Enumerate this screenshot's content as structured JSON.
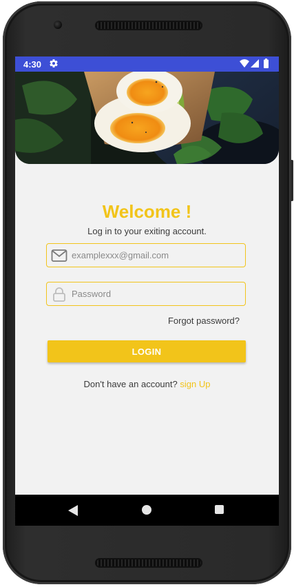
{
  "status_bar": {
    "time": "4:30",
    "settings_icon": "gear-icon",
    "wifi_icon": "wifi-icon",
    "signal_icon": "cell-signal-icon",
    "battery_icon": "battery-icon",
    "background_color": "#3d4fd6"
  },
  "hero": {
    "image": "food-photo-eggs-avocado-toast"
  },
  "login": {
    "title": "Welcome !",
    "subtitle": "Log in to your exiting account.",
    "email_placeholder": "examplexxx@gmail.com",
    "email_icon": "mail-icon",
    "password_placeholder": "Password",
    "password_icon": "lock-icon",
    "forgot_password": "Forgot password?",
    "login_button": "LOGIN",
    "signup_prompt": "Don't have an account?",
    "signup_link": "sign Up",
    "accent_color": "#f2c41a"
  },
  "nav_bar": {
    "back_icon": "back-triangle-icon",
    "home_icon": "home-circle-icon",
    "recents_icon": "recents-square-icon"
  }
}
